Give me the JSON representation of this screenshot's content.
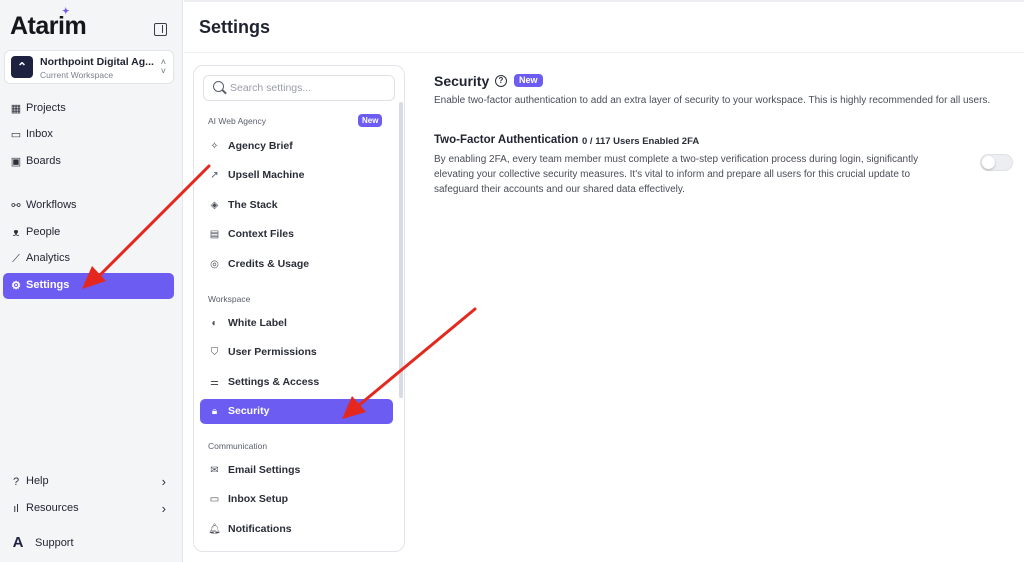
{
  "app": {
    "logo": "Atarim",
    "workspace_name": "Northpoint Digital Ag...",
    "workspace_sub": "Current Workspace"
  },
  "sidebar": {
    "items": [
      {
        "label": "Projects",
        "icon": "grid-icon"
      },
      {
        "label": "Inbox",
        "icon": "inbox-icon"
      },
      {
        "label": "Boards",
        "icon": "board-icon"
      },
      {
        "label": "Workflows",
        "icon": "workflow-icon"
      },
      {
        "label": "People",
        "icon": "person-icon"
      },
      {
        "label": "Analytics",
        "icon": "chart-icon"
      },
      {
        "label": "Settings",
        "icon": "gear-icon",
        "active": true
      }
    ],
    "bottom": [
      {
        "label": "Help",
        "icon": "help-circle-icon"
      },
      {
        "label": "Resources",
        "icon": "bar-icon"
      }
    ],
    "support_label": "Support"
  },
  "header": {
    "title": "Settings"
  },
  "settings_menu": {
    "search_placeholder": "Search settings...",
    "sections": [
      {
        "label": "AI Web Agency",
        "badge": "New"
      },
      {
        "label": "Workspace"
      },
      {
        "label": "Communication"
      }
    ],
    "items": [
      {
        "label": "Agency Brief",
        "icon": "sparkle-icon"
      },
      {
        "label": "Upsell Machine",
        "icon": "trend-icon"
      },
      {
        "label": "The Stack",
        "icon": "layers-icon"
      },
      {
        "label": "Context Files",
        "icon": "file-icon"
      },
      {
        "label": "Credits & Usage",
        "icon": "coins-icon"
      },
      {
        "label": "White Label",
        "icon": "palette-icon"
      },
      {
        "label": "User Permissions",
        "icon": "shield-icon"
      },
      {
        "label": "Settings & Access",
        "icon": "sliders-icon"
      },
      {
        "label": "Security",
        "icon": "lock-icon",
        "active": true
      },
      {
        "label": "Email Settings",
        "icon": "mail-icon"
      },
      {
        "label": "Inbox Setup",
        "icon": "inbox-icon"
      },
      {
        "label": "Notifications",
        "icon": "bell-icon"
      }
    ]
  },
  "content": {
    "title": "Security",
    "badge": "New",
    "description": "Enable two-factor authentication to add an extra layer of security to your workspace. This is highly recommended for all users.",
    "tfa": {
      "title": "Two-Factor Authentication",
      "count": "0 / 117 Users Enabled 2FA",
      "description": "By enabling 2FA, every team member must complete a two-step verification process during login, significantly elevating your collective security measures. It's vital to inform and prepare all users for this crucial update to safeguard their accounts and our shared data effectively.",
      "enabled": false
    }
  },
  "colors": {
    "accent": "#6c5cf2",
    "annotation_arrow": "#e5281e"
  }
}
